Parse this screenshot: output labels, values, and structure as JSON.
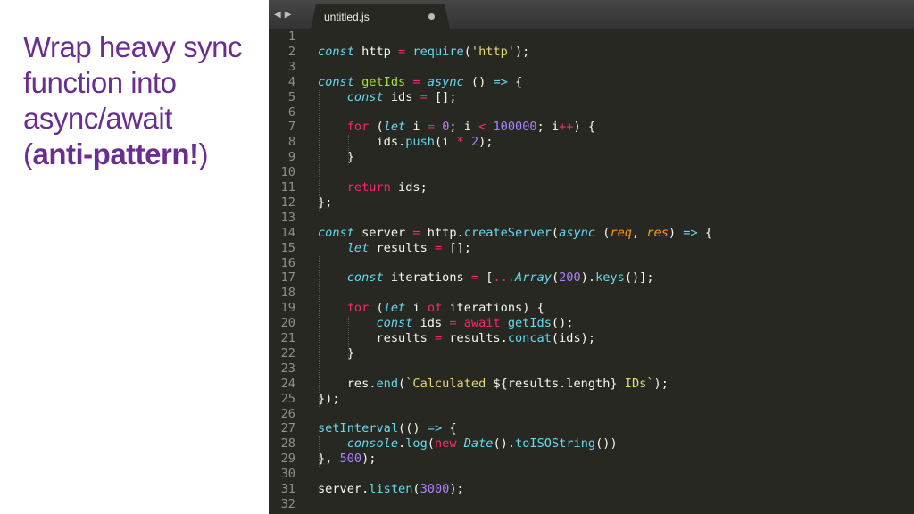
{
  "slide": {
    "title_lines": [
      "Wrap heavy sync",
      "function into",
      "async/await"
    ],
    "title_last_open": "(",
    "title_last_strong": "anti-pattern!",
    "title_last_close": ")"
  },
  "editor": {
    "nav_back": "◀",
    "nav_forward": "▶",
    "tab_title": "untitled.js",
    "theme_colors": {
      "background": "#272822",
      "keyword": "#f92672",
      "storage": "#66d9ef",
      "function": "#a6e22e",
      "string": "#e6db74",
      "number": "#ae81ff",
      "parameter": "#fd971f",
      "plain": "#f8f8f2"
    },
    "lines": [
      {
        "n": "1",
        "tokens": []
      },
      {
        "n": "2",
        "tokens": [
          [
            "storage",
            "const"
          ],
          [
            "plain",
            " http "
          ],
          [
            "op",
            "="
          ],
          [
            "plain",
            " "
          ],
          [
            "builtin",
            "require"
          ],
          [
            "plain",
            "("
          ],
          [
            "string",
            "'http'"
          ],
          [
            "plain",
            ");"
          ]
        ]
      },
      {
        "n": "3",
        "tokens": []
      },
      {
        "n": "4",
        "tokens": [
          [
            "storage",
            "const"
          ],
          [
            "plain",
            " "
          ],
          [
            "func",
            "getIds"
          ],
          [
            "plain",
            " "
          ],
          [
            "op",
            "="
          ],
          [
            "plain",
            " "
          ],
          [
            "storage",
            "async"
          ],
          [
            "plain",
            " () "
          ],
          [
            "storage",
            "=>"
          ],
          [
            "plain",
            " {"
          ]
        ]
      },
      {
        "n": "5",
        "tokens": [
          [
            "plain",
            "    "
          ],
          [
            "storage",
            "const"
          ],
          [
            "plain",
            " ids "
          ],
          [
            "op",
            "="
          ],
          [
            "plain",
            " [];"
          ]
        ]
      },
      {
        "n": "6",
        "tokens": []
      },
      {
        "n": "7",
        "tokens": [
          [
            "plain",
            "    "
          ],
          [
            "keyword",
            "for"
          ],
          [
            "plain",
            " ("
          ],
          [
            "storage",
            "let"
          ],
          [
            "plain",
            " i "
          ],
          [
            "op",
            "="
          ],
          [
            "plain",
            " "
          ],
          [
            "number",
            "0"
          ],
          [
            "plain",
            "; i "
          ],
          [
            "op",
            "<"
          ],
          [
            "plain",
            " "
          ],
          [
            "number",
            "100000"
          ],
          [
            "plain",
            "; i"
          ],
          [
            "op",
            "++"
          ],
          [
            "plain",
            ") {"
          ]
        ]
      },
      {
        "n": "8",
        "tokens": [
          [
            "plain",
            "        ids."
          ],
          [
            "builtin",
            "push"
          ],
          [
            "plain",
            "(i "
          ],
          [
            "op",
            "*"
          ],
          [
            "plain",
            " "
          ],
          [
            "number",
            "2"
          ],
          [
            "plain",
            ");"
          ]
        ]
      },
      {
        "n": "9",
        "tokens": [
          [
            "plain",
            "    }"
          ]
        ]
      },
      {
        "n": "10",
        "tokens": []
      },
      {
        "n": "11",
        "tokens": [
          [
            "plain",
            "    "
          ],
          [
            "keyword",
            "return"
          ],
          [
            "plain",
            " ids;"
          ]
        ]
      },
      {
        "n": "12",
        "tokens": [
          [
            "plain",
            "};"
          ]
        ]
      },
      {
        "n": "13",
        "tokens": []
      },
      {
        "n": "14",
        "tokens": [
          [
            "storage",
            "const"
          ],
          [
            "plain",
            " server "
          ],
          [
            "op",
            "="
          ],
          [
            "plain",
            " http."
          ],
          [
            "builtin",
            "createServer"
          ],
          [
            "plain",
            "("
          ],
          [
            "storage",
            "async"
          ],
          [
            "plain",
            " ("
          ],
          [
            "param",
            "req"
          ],
          [
            "plain",
            ", "
          ],
          [
            "param",
            "res"
          ],
          [
            "plain",
            ") "
          ],
          [
            "storage",
            "=>"
          ],
          [
            "plain",
            " {"
          ]
        ]
      },
      {
        "n": "15",
        "tokens": [
          [
            "plain",
            "    "
          ],
          [
            "storage",
            "let"
          ],
          [
            "plain",
            " results "
          ],
          [
            "op",
            "="
          ],
          [
            "plain",
            " [];"
          ]
        ]
      },
      {
        "n": "16",
        "tokens": []
      },
      {
        "n": "17",
        "tokens": [
          [
            "plain",
            "    "
          ],
          [
            "storage",
            "const"
          ],
          [
            "plain",
            " iterations "
          ],
          [
            "op",
            "="
          ],
          [
            "plain",
            " ["
          ],
          [
            "op",
            "..."
          ],
          [
            "class",
            "Array"
          ],
          [
            "plain",
            "("
          ],
          [
            "number",
            "200"
          ],
          [
            "plain",
            ")."
          ],
          [
            "builtin",
            "keys"
          ],
          [
            "plain",
            "()];"
          ]
        ]
      },
      {
        "n": "18",
        "tokens": []
      },
      {
        "n": "19",
        "tokens": [
          [
            "plain",
            "    "
          ],
          [
            "keyword",
            "for"
          ],
          [
            "plain",
            " ("
          ],
          [
            "storage",
            "let"
          ],
          [
            "plain",
            " i "
          ],
          [
            "keyword",
            "of"
          ],
          [
            "plain",
            " iterations) {"
          ]
        ]
      },
      {
        "n": "20",
        "tokens": [
          [
            "plain",
            "        "
          ],
          [
            "storage",
            "const"
          ],
          [
            "plain",
            " ids "
          ],
          [
            "op",
            "="
          ],
          [
            "plain",
            " "
          ],
          [
            "keyword",
            "await"
          ],
          [
            "plain",
            " "
          ],
          [
            "builtin",
            "getIds"
          ],
          [
            "plain",
            "();"
          ]
        ]
      },
      {
        "n": "21",
        "tokens": [
          [
            "plain",
            "        results "
          ],
          [
            "op",
            "="
          ],
          [
            "plain",
            " results."
          ],
          [
            "builtin",
            "concat"
          ],
          [
            "plain",
            "(ids);"
          ]
        ]
      },
      {
        "n": "22",
        "tokens": [
          [
            "plain",
            "    }"
          ]
        ]
      },
      {
        "n": "23",
        "tokens": []
      },
      {
        "n": "24",
        "tokens": [
          [
            "plain",
            "    res."
          ],
          [
            "builtin",
            "end"
          ],
          [
            "plain",
            "("
          ],
          [
            "string",
            "`Calculated "
          ],
          [
            "plain",
            "${results.length}"
          ],
          [
            "string",
            " IDs`"
          ],
          [
            "plain",
            ");"
          ]
        ]
      },
      {
        "n": "25",
        "tokens": [
          [
            "plain",
            "});"
          ]
        ]
      },
      {
        "n": "26",
        "tokens": []
      },
      {
        "n": "27",
        "tokens": [
          [
            "builtin",
            "setInterval"
          ],
          [
            "plain",
            "(() "
          ],
          [
            "storage",
            "=>"
          ],
          [
            "plain",
            " {"
          ]
        ]
      },
      {
        "n": "28",
        "tokens": [
          [
            "plain",
            "    "
          ],
          [
            "class",
            "console"
          ],
          [
            "plain",
            "."
          ],
          [
            "builtin",
            "log"
          ],
          [
            "plain",
            "("
          ],
          [
            "keyword",
            "new"
          ],
          [
            "plain",
            " "
          ],
          [
            "class",
            "Date"
          ],
          [
            "plain",
            "()."
          ],
          [
            "builtin",
            "toISOString"
          ],
          [
            "plain",
            "())"
          ]
        ]
      },
      {
        "n": "29",
        "tokens": [
          [
            "plain",
            "}, "
          ],
          [
            "number",
            "500"
          ],
          [
            "plain",
            ");"
          ]
        ]
      },
      {
        "n": "30",
        "tokens": []
      },
      {
        "n": "31",
        "tokens": [
          [
            "plain",
            "server."
          ],
          [
            "builtin",
            "listen"
          ],
          [
            "plain",
            "("
          ],
          [
            "number",
            "3000"
          ],
          [
            "plain",
            ");"
          ]
        ]
      },
      {
        "n": "32",
        "tokens": []
      }
    ]
  }
}
